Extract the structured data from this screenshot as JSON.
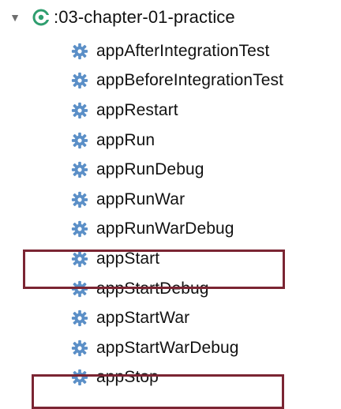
{
  "tree": {
    "root": {
      "label": ":03-chapter-01-practice",
      "expanded": true,
      "disclosure_icon": "triangle-down-icon",
      "module_icon": "gradle-module-icon",
      "module_icon_color": "#2f9e6f"
    },
    "tasks": [
      {
        "label": "appAfterIntegrationTest",
        "icon": "gear-icon"
      },
      {
        "label": "appBeforeIntegrationTest",
        "icon": "gear-icon"
      },
      {
        "label": "appRestart",
        "icon": "gear-icon"
      },
      {
        "label": "appRun",
        "icon": "gear-icon"
      },
      {
        "label": "appRunDebug",
        "icon": "gear-icon"
      },
      {
        "label": "appRunWar",
        "icon": "gear-icon"
      },
      {
        "label": "appRunWarDebug",
        "icon": "gear-icon"
      },
      {
        "label": "appStart",
        "icon": "gear-icon",
        "highlighted": true
      },
      {
        "label": "appStartDebug",
        "icon": "gear-icon"
      },
      {
        "label": "appStartWar",
        "icon": "gear-icon"
      },
      {
        "label": "appStartWarDebug",
        "icon": "gear-icon"
      },
      {
        "label": "appStop",
        "icon": "gear-icon",
        "highlighted": true
      }
    ],
    "colors": {
      "gear": "#5b8fc7",
      "highlight_border": "#7b2533",
      "text": "#111111"
    }
  }
}
